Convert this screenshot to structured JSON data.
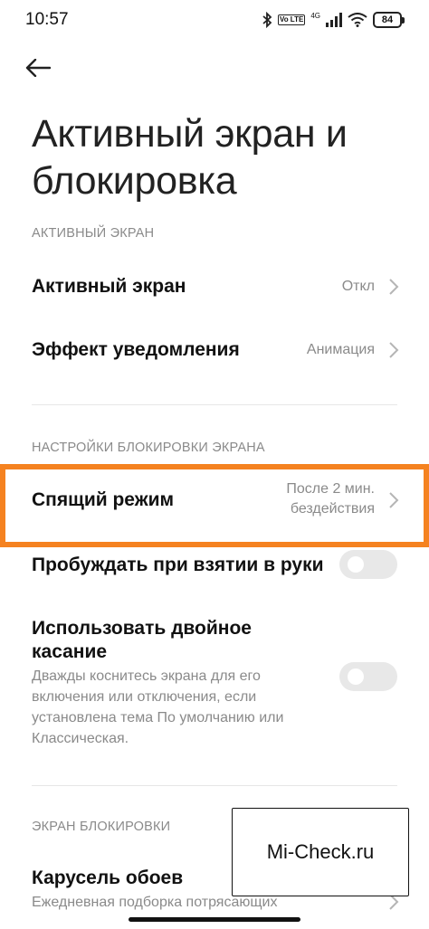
{
  "status_bar": {
    "time": "10:57",
    "lte": "Vo LTE",
    "network": "4G",
    "battery": "84"
  },
  "header": {
    "title": "Активный экран и блокировка"
  },
  "sections": [
    {
      "header": "АКТИВНЫЙ ЭКРАН",
      "items": [
        {
          "label": "Активный экран",
          "value": "Откл"
        },
        {
          "label": "Эффект уведомления",
          "value": "Анимация"
        }
      ]
    },
    {
      "header": "НАСТРОЙКИ БЛОКИРОВКИ ЭКРАНА",
      "items": [
        {
          "label": "Спящий режим",
          "value_line1": "После 2 мин.",
          "value_line2": "бездействия"
        },
        {
          "label": "Пробуждать при взятии в руки",
          "toggle_on": false
        },
        {
          "label_line1": "Использовать двойное",
          "label_line2": "касание",
          "description_lines": [
            "Дважды коснитесь экрана для его",
            "включения или отключения, если",
            "установлена тема По умолчанию или",
            "Классическая."
          ],
          "toggle_on": false
        }
      ]
    },
    {
      "header": "ЭКРАН БЛОКИРОВКИ",
      "items": [
        {
          "label": "Карусель обоев",
          "description": "Ежедневная подборка потрясающих"
        }
      ]
    }
  ],
  "colors": {
    "highlight": "#f58220",
    "secondary_text": "#8a8a8a",
    "toggle_off": "#e8e8e8"
  },
  "watermark": "Mi-Check.ru"
}
